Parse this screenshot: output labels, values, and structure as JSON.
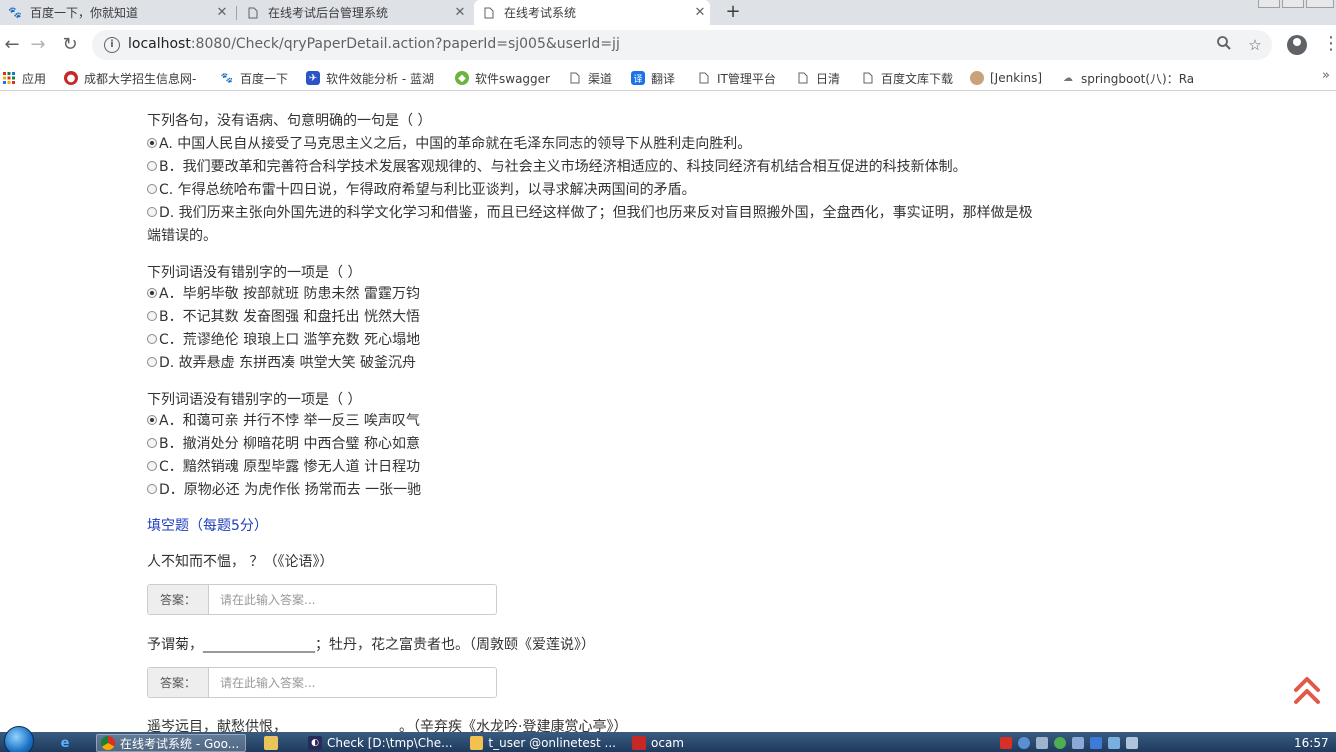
{
  "browser": {
    "tabs": [
      {
        "title": "百度一下，你就知道",
        "active": false
      },
      {
        "title": "在线考试后台管理系统",
        "active": false
      },
      {
        "title": "在线考试系统",
        "active": true
      }
    ],
    "url_host": "localhost",
    "url_rest": ":8080/Check/qryPaperDetail.action?paperId=sj005&userId=jj",
    "bookmarks": [
      "应用",
      "成都大学招生信息网-",
      "百度一下",
      "软件效能分析 - 蓝湖",
      "软件swagger",
      "渠道",
      "翻译",
      "IT管理平台",
      "日清",
      "百度文库下载",
      "[Jenkins]",
      "springboot(八)：Ra"
    ]
  },
  "questions": [
    {
      "stem": "下列各句，没有语病、句意明确的一句是（   ）",
      "options": [
        {
          "text": "A. 中国人民自从接受了马克思主义之后，中国的革命就在毛泽东同志的领导下从胜利走向胜利。",
          "checked": true
        },
        {
          "text": "B．我们要改革和完善符合科学技术发展客观规律的、与社会主义市场经济相适应的、科技同经济有机结合相互促进的科技新体制。",
          "checked": false
        },
        {
          "text": "C. 乍得总统哈布雷十四日说，乍得政府希望与利比亚谈判，以寻求解决两国间的矛盾。",
          "checked": false
        },
        {
          "text": "D. 我们历来主张向外国先进的科学文化学习和借鉴，而且已经这样做了；但我们也历来反对盲目照搬外国，全盘西化，事实证明，那样做是极",
          "checked": false,
          "continuation": "端错误的。"
        }
      ]
    },
    {
      "stem": "下列词语没有错别字的一项是（   ）",
      "options": [
        {
          "text": "A．毕躬毕敬 按部就班 防患未然 雷霆万钧",
          "checked": true
        },
        {
          "text": "B．不记其数 发奋图强 和盘托出 恍然大悟",
          "checked": false
        },
        {
          "text": "C．荒谬绝伦 琅琅上口 滥竽充数 死心塌地",
          "checked": false
        },
        {
          "text": "D. 故弄悬虚 东拼西凑 哄堂大笑 破釜沉舟",
          "checked": false
        }
      ]
    },
    {
      "stem": "下列词语没有错别字的一项是（   ）",
      "options": [
        {
          "text": "A．和蔼可亲 并行不悖 举一反三 唉声叹气",
          "checked": true
        },
        {
          "text": "B．撤消处分 柳暗花明 中西合璧 称心如意",
          "checked": false
        },
        {
          "text": "C．黯然销魂 原型毕露 惨无人道 计日程功",
          "checked": false
        },
        {
          "text": "D．原物必还 为虎作伥 扬常而去 一张一驰",
          "checked": false
        }
      ]
    }
  ],
  "fill_section": {
    "title": "填空题（每题5分）",
    "items": [
      {
        "text": "人不知而不愠，  ？（《论语》）",
        "answer_label": "答案：",
        "placeholder": "请在此输入答案..."
      },
      {
        "text": "予谓菊，________________；牡丹，花之富贵者也。（周敦颐《爱莲说》）",
        "answer_label": "答案：",
        "placeholder": "请在此输入答案..."
      },
      {
        "text": "遥岑远目，献愁供恨，________________。（辛弃疾《水龙吟·登建康赏心亭》）"
      }
    ]
  },
  "taskbar": {
    "items": [
      "在线考试系统 - Goo...",
      "",
      "Check [D:\\tmp\\Che...",
      "t_user @onlinetest ...",
      "ocam"
    ],
    "time": "16:57"
  },
  "colors": {
    "section_blue": "#1f3fbf",
    "back_top_red": "#e05a4a"
  }
}
